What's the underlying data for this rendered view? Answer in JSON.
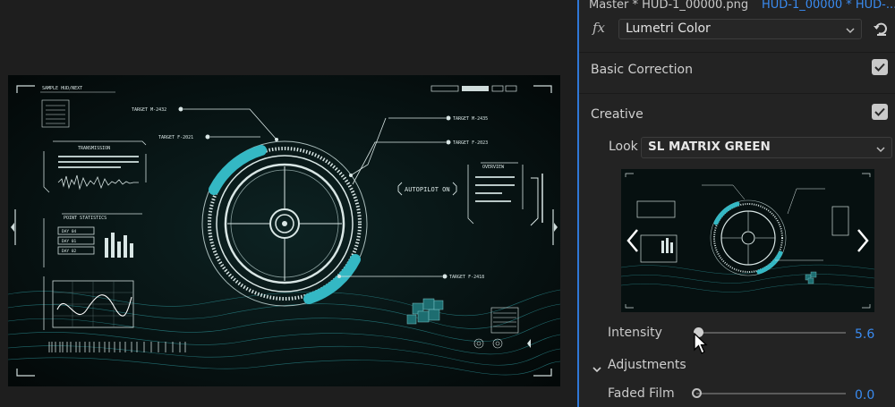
{
  "tabs": {
    "master": "Master * HUD-1_00000.png",
    "clip": "HUD-1_00000 * HUD-..."
  },
  "effect": {
    "fx_symbol": "fx",
    "name": "Lumetri Color"
  },
  "sections": {
    "basic_correction": {
      "title": "Basic Correction",
      "enabled": true
    },
    "creative": {
      "title": "Creative",
      "enabled": true
    }
  },
  "look": {
    "label": "Look",
    "value": "SL MATRIX GREEN"
  },
  "intensity": {
    "label": "Intensity",
    "value": "5.6",
    "fraction": 0.0
  },
  "adjustments": {
    "title": "Adjustments"
  },
  "faded_film": {
    "label": "Faded Film",
    "value": "0.0",
    "fraction": 0.0
  },
  "hud": {
    "top_left_title": "SAMPLE HUD/NEXT",
    "transmission": "TRANSMISSION",
    "point_stats": "POINT STATISTICS",
    "day_a": "DAY 04",
    "day_b": "DAY 01",
    "day_c": "DAY 02",
    "autopilot": "AUTOPILOT ON",
    "overview": "OVERVIEW",
    "target_1": "TARGET M-2432",
    "target_2": "TARGET F-2021",
    "target_3": "TARGET M-2435",
    "target_4": "TARGET F-2023",
    "target_5": "TARGET F-2418"
  },
  "colors": {
    "accent_blue": "#3a8bf0",
    "hud_cyan": "#34b8c4",
    "hud_white": "#d9e6e5"
  }
}
